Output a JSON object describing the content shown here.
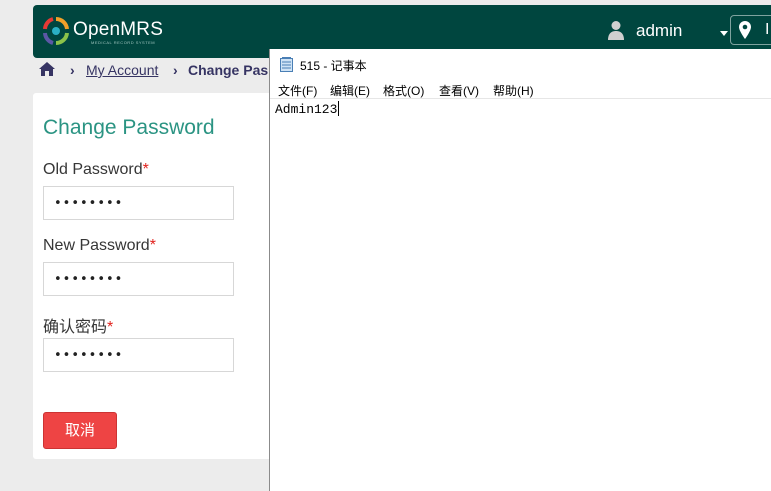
{
  "header": {
    "logo_text": "OpenMRS",
    "logo_subtitle": "MEDICAL RECORD SYSTEM",
    "user_name": "admin",
    "location_text": "I"
  },
  "breadcrumb": {
    "sep": "›",
    "account_link": "My Account",
    "current": "Change Pas"
  },
  "form": {
    "title": "Change Password",
    "old_password_label": "Old Password",
    "new_password_label": "New Password",
    "confirm_label": "确认密码",
    "required_mark": "*",
    "masked_value": "••••••••",
    "cancel_label": "取消"
  },
  "notepad": {
    "title": "515 - 记事本",
    "menu": [
      "文件(F)",
      "编辑(E)",
      "格式(O)",
      "查看(V)",
      "帮助(H)"
    ],
    "content": "Admin123"
  },
  "colors": {
    "header_bg": "#00463f",
    "title_teal": "#2b9483",
    "cancel_red": "#ee4444",
    "required_red": "#e1211c"
  }
}
